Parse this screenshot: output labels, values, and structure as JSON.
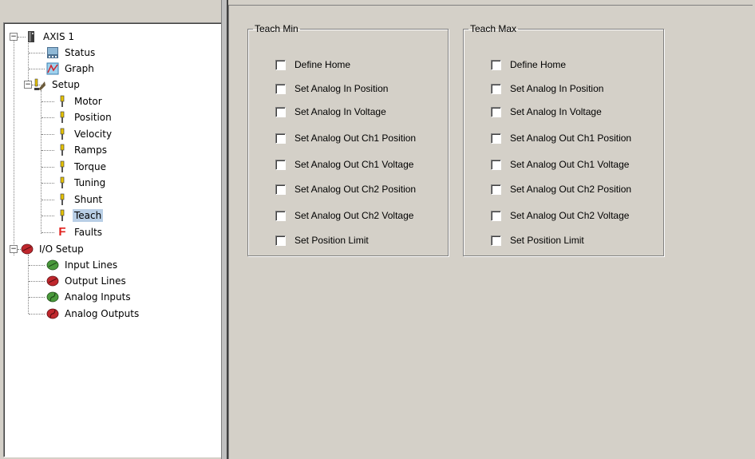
{
  "tree": {
    "root": {
      "label": "AXIS 1"
    },
    "items": [
      {
        "label": "Status"
      },
      {
        "label": "Graph"
      },
      {
        "label": "Setup"
      },
      {
        "label": "Motor"
      },
      {
        "label": "Position"
      },
      {
        "label": "Velocity"
      },
      {
        "label": "Ramps"
      },
      {
        "label": "Torque"
      },
      {
        "label": "Tuning"
      },
      {
        "label": "Shunt"
      },
      {
        "label": "Teach"
      },
      {
        "label": "Faults"
      },
      {
        "label": "I/O Setup"
      },
      {
        "label": "Input Lines"
      },
      {
        "label": "Output Lines"
      },
      {
        "label": "Analog Inputs"
      },
      {
        "label": "Analog Outputs"
      }
    ],
    "selected": "Teach",
    "faults_glyph": "F"
  },
  "teach_min": {
    "title": "Teach Min",
    "options": [
      {
        "label": "Define Home",
        "checked": false
      },
      {
        "label": "Set Analog In Position",
        "checked": false
      },
      {
        "label": "Set Analog In Voltage",
        "checked": false
      },
      {
        "label": "Set Analog Out Ch1 Position",
        "checked": false
      },
      {
        "label": "Set Analog Out Ch1 Voltage",
        "checked": false
      },
      {
        "label": "Set Analog Out Ch2 Position",
        "checked": false
      },
      {
        "label": "Set Analog Out Ch2 Voltage",
        "checked": false
      },
      {
        "label": "Set Position Limit",
        "checked": false
      }
    ]
  },
  "teach_max": {
    "title": "Teach Max",
    "options": [
      {
        "label": "Define Home",
        "checked": false
      },
      {
        "label": "Set Analog In Position",
        "checked": false
      },
      {
        "label": "Set Analog In Voltage",
        "checked": false
      },
      {
        "label": "Set Analog Out Ch1 Position",
        "checked": false
      },
      {
        "label": "Set Analog Out Ch1 Voltage",
        "checked": false
      },
      {
        "label": "Set Analog Out Ch2 Position",
        "checked": false
      },
      {
        "label": "Set Analog Out Ch2 Voltage",
        "checked": false
      },
      {
        "label": "Set Position Limit",
        "checked": false
      }
    ]
  },
  "icons": {
    "axis": "drive-icon",
    "status": "status-monitor-icon",
    "graph": "graph-icon",
    "setup": "setup-tools-icon",
    "param": "parameter-icon",
    "faults": "fault-icon",
    "io": "io-icon"
  },
  "colors": {
    "selection": "#b9cfe6",
    "panel": "#d4d0c8",
    "fault": "#e0201c",
    "io_red": "#c0272d",
    "io_green": "#4a9a3c"
  }
}
